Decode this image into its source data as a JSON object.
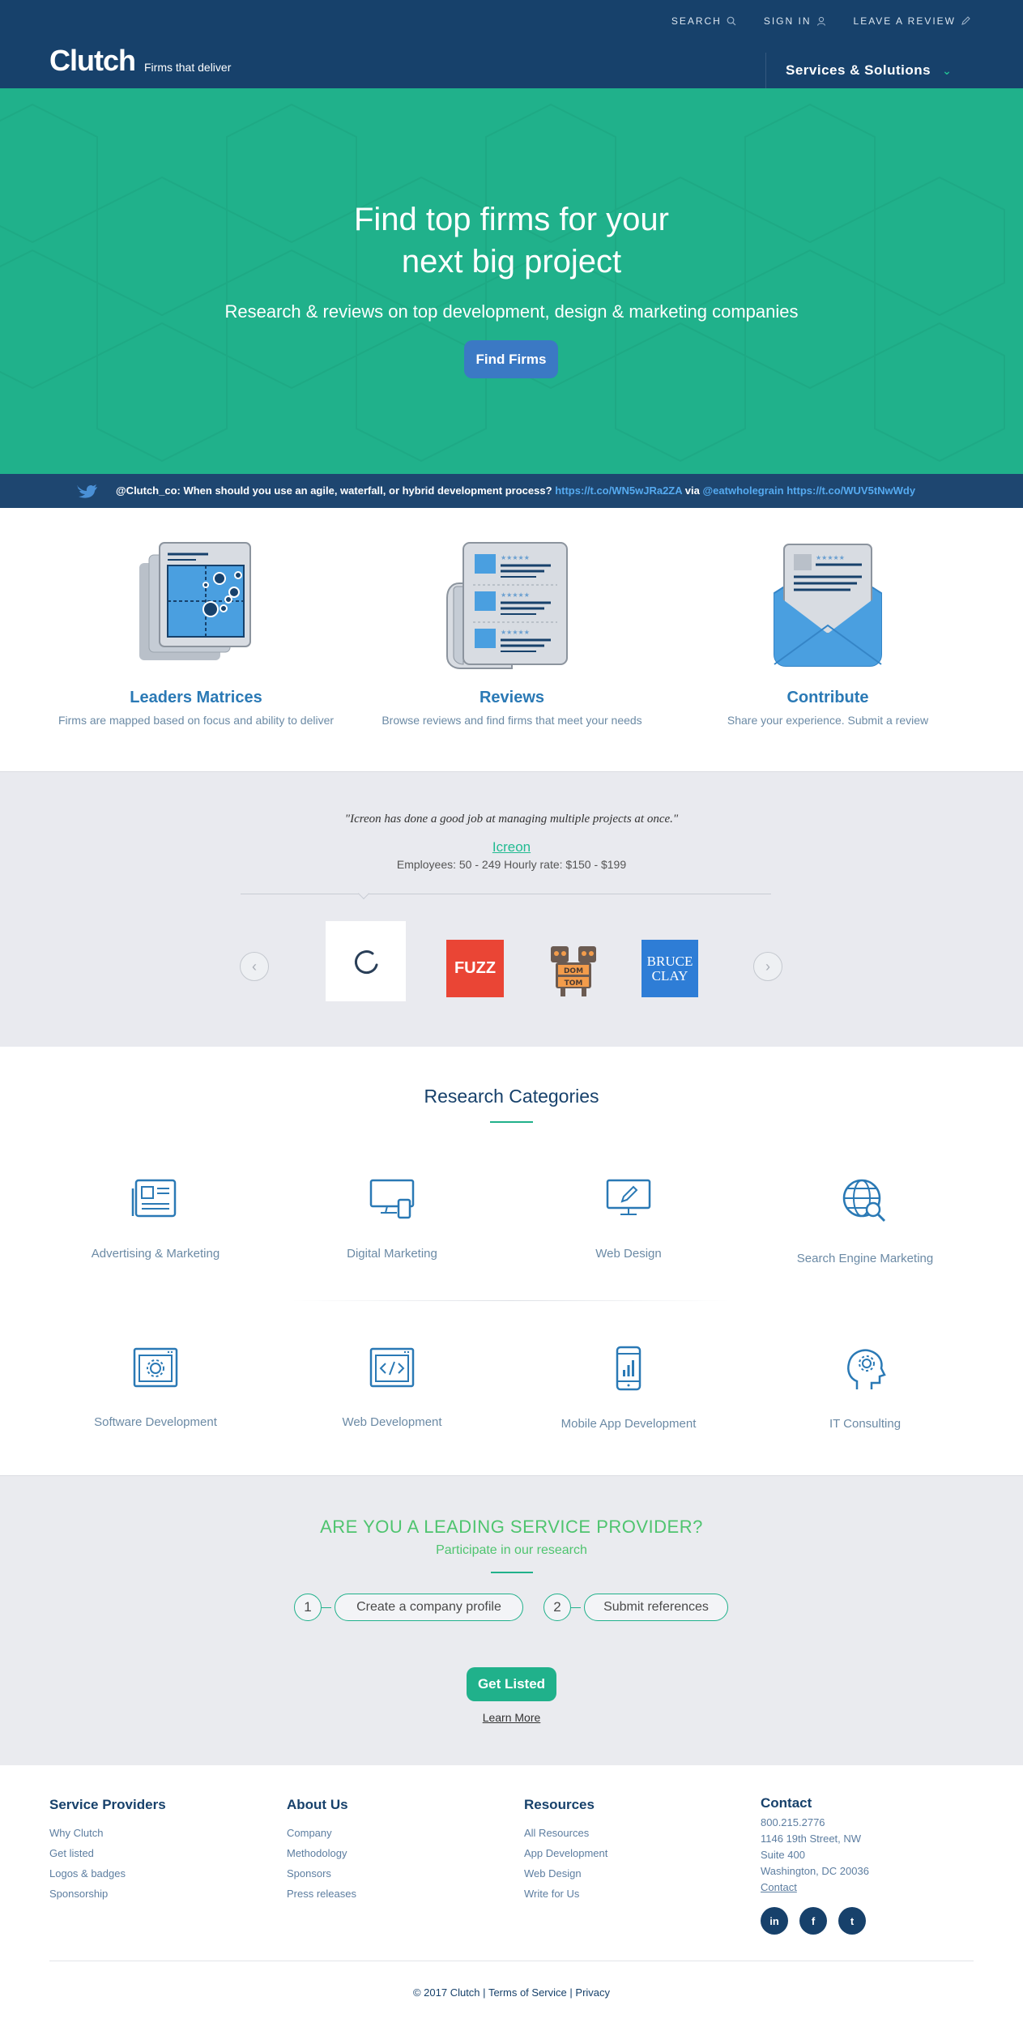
{
  "header": {
    "search": "SEARCH",
    "sign_in": "SIGN IN",
    "leave_review": "LEAVE A REVIEW",
    "logo": "Clutch",
    "tagline": "Firms that deliver",
    "services": "Services & Solutions"
  },
  "hero": {
    "title_line1": "Find top firms for your",
    "title_line2": "next big project",
    "subtitle": "Research & reviews on top development, design & marketing companies",
    "button": "Find Firms"
  },
  "tweet": {
    "text": "@Clutch_co: When should you use an agile, waterfall, or hybrid development process?",
    "link1": "https://t.co/WN5wJRa2ZA",
    "via": "via",
    "handle": "@eatwholegrain",
    "link2": "https://t.co/WUV5tNwWdy"
  },
  "features": [
    {
      "title": "Leaders Matrices",
      "desc": "Firms are mapped based on focus and ability to deliver"
    },
    {
      "title": "Reviews",
      "desc": "Browse reviews and find firms that meet your needs"
    },
    {
      "title": "Contribute",
      "desc": "Share your experience. Submit a review"
    }
  ],
  "review": {
    "quote": "\"Icreon has done a good job at managing multiple projects at once.\"",
    "company": "Icreon",
    "meta": "Employees: 50 - 249    Hourly rate: $150 - $199",
    "logos": [
      "icreon",
      "FUZZ",
      "DOM & TOM",
      "BRUCE CLAY"
    ],
    "fuzz_label": "FUZZ",
    "domtom_l1": "DOM",
    "domtom_l2": "TOM",
    "bruce_l1": "BRUCE",
    "bruce_l2": "CLAY"
  },
  "categories": {
    "title": "Research Categories",
    "items": [
      {
        "label": "Advertising & Marketing",
        "icon": "newspaper-icon"
      },
      {
        "label": "Digital Marketing",
        "icon": "devices-icon"
      },
      {
        "label": "Web Design",
        "icon": "monitor-pen-icon"
      },
      {
        "label": "Search Engine Marketing",
        "icon": "globe-search-icon"
      },
      {
        "label": "Software Development",
        "icon": "gear-window-icon"
      },
      {
        "label": "Web Development",
        "icon": "code-window-icon"
      },
      {
        "label": "Mobile App Development",
        "icon": "mobile-icon"
      },
      {
        "label": "IT Consulting",
        "icon": "head-gear-icon"
      }
    ]
  },
  "provider": {
    "heading": "ARE YOU A LEADING SERVICE PROVIDER?",
    "sub": "Participate in our research",
    "step1_num": "1",
    "step1": "Create a company profile",
    "step2_num": "2",
    "step2": "Submit references",
    "button": "Get Listed",
    "learn_more": "Learn More"
  },
  "footer": {
    "col1": {
      "title": "Service Providers",
      "links": [
        "Why Clutch",
        "Get listed",
        "Logos & badges",
        "Sponsorship"
      ]
    },
    "col2": {
      "title": "About Us",
      "links": [
        "Company",
        "Methodology",
        "Sponsors",
        "Press releases"
      ]
    },
    "col3": {
      "title": "Resources",
      "links": [
        "All Resources",
        "App Development",
        "Web Design",
        "Write for Us"
      ]
    },
    "contact": {
      "title": "Contact",
      "phone": "800.215.2776",
      "address1": "1146 19th Street, NW",
      "address2": "Suite 400",
      "address3": "Washington, DC 20036",
      "link": "Contact"
    },
    "social": [
      "in",
      "f",
      "t"
    ],
    "copyright": "© 2017 Clutch",
    "sep": "|",
    "terms": "Terms of Service",
    "privacy": "Privacy"
  },
  "colors": {
    "navy": "#17416b",
    "teal": "#20b18b",
    "blue_button": "#3b79c4",
    "link_blue": "#2a79b5",
    "green_heading": "#4fc46f"
  }
}
